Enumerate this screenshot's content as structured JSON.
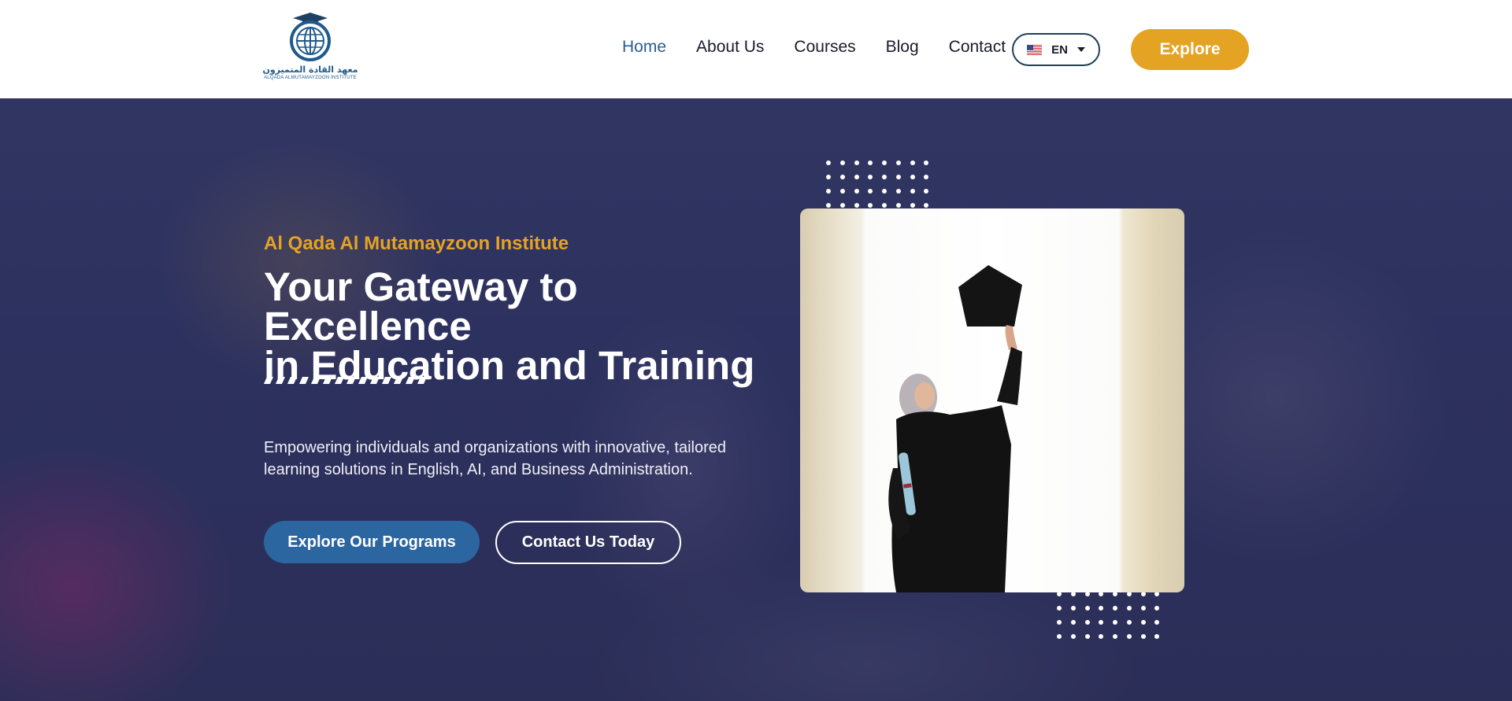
{
  "header": {
    "logo": {
      "name_ar": "معهد القادة المتميزون",
      "name_en": "ALQADA ALMUTAMAYZOON INSTITUTE"
    },
    "nav": [
      {
        "label": "Home",
        "active": true
      },
      {
        "label": "About Us",
        "active": false
      },
      {
        "label": "Courses",
        "active": false
      },
      {
        "label": "Blog",
        "active": false
      },
      {
        "label": "Contact",
        "active": false
      }
    ],
    "language": {
      "code": "EN",
      "flag_icon": "us-flag-icon"
    },
    "explore_label": "Explore"
  },
  "hero": {
    "eyebrow": "Al Qada Al Mutamayzoon Institute",
    "headline_line1": "Your Gateway to Excellence",
    "headline_line2": "in Education and Training",
    "description_line1": "Empowering individuals and organizations with innovative, tailored",
    "description_line2": "learning solutions in English, AI, and Business Administration.",
    "primary_button": "Explore Our Programs",
    "secondary_button": "Contact Us Today"
  },
  "colors": {
    "accent": "#e5a324",
    "primary": "#2c66a0",
    "nav_active": "#2a5d8f",
    "header_bg": "#ffffff",
    "hero_overlay": "#2c2f5c"
  }
}
